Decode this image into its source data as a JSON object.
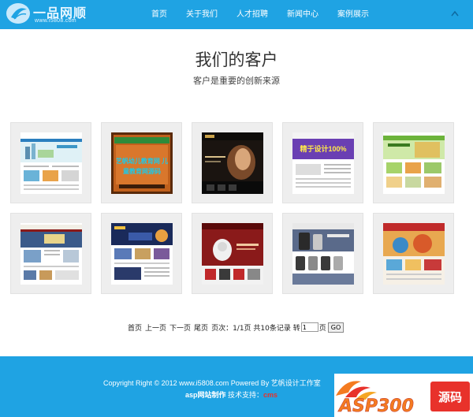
{
  "header": {
    "logo_title": "一品网顺",
    "logo_url": "www.i5808.com",
    "nav": [
      "首页",
      "关于我们",
      "人才招聘",
      "新闻中心",
      "案例展示"
    ]
  },
  "title": "我们的客户",
  "subtitle": "客户是重要的创新来源",
  "cases": [
    {
      "label": ""
    },
    {
      "label": "艺帆幼儿教育网 儿童教育网源码"
    },
    {
      "label": ""
    },
    {
      "label": "精于设计100%"
    },
    {
      "label": ""
    },
    {
      "label": ""
    },
    {
      "label": ""
    },
    {
      "label": ""
    },
    {
      "label": ""
    },
    {
      "label": ""
    }
  ],
  "pager": {
    "first": "首页",
    "prev": "上一页",
    "next": "下一页",
    "last": "尾页",
    "info": "页次：1/1页 共10条记录 转",
    "input_value": "1",
    "page_unit": "页",
    "go": "GO"
  },
  "footer": {
    "copyright": "Copyright Right © 2012 www.i5808.com Powered By 艺帆设计工作室",
    "made_by": "asp网站制作",
    "support_label": "技术支持：",
    "support_value": "cms"
  },
  "badge": {
    "brand": "ASP300",
    "suffix": "源码"
  },
  "colors": {
    "brand_blue": "#1fa3e3",
    "badge_orange": "#f47b20",
    "badge_red": "#e8322b"
  }
}
